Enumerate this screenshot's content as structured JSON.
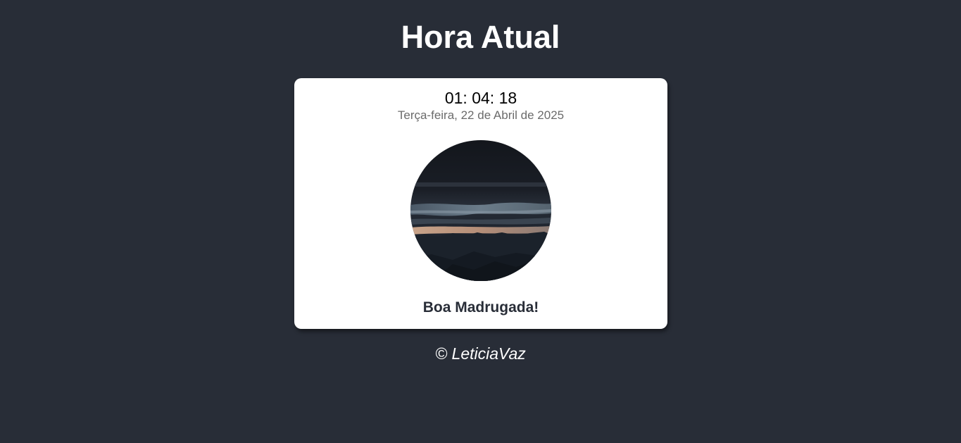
{
  "page": {
    "title": "Hora Atual",
    "background_color": "#282d37"
  },
  "clock": {
    "time": "01: 04: 18",
    "date": "Terça-feira, 22 de Abril de 2025",
    "image_icon": "night-mountain-landscape",
    "greeting": "Boa Madrugada!"
  },
  "footer": {
    "copyright": "© LeticiaVaz"
  }
}
